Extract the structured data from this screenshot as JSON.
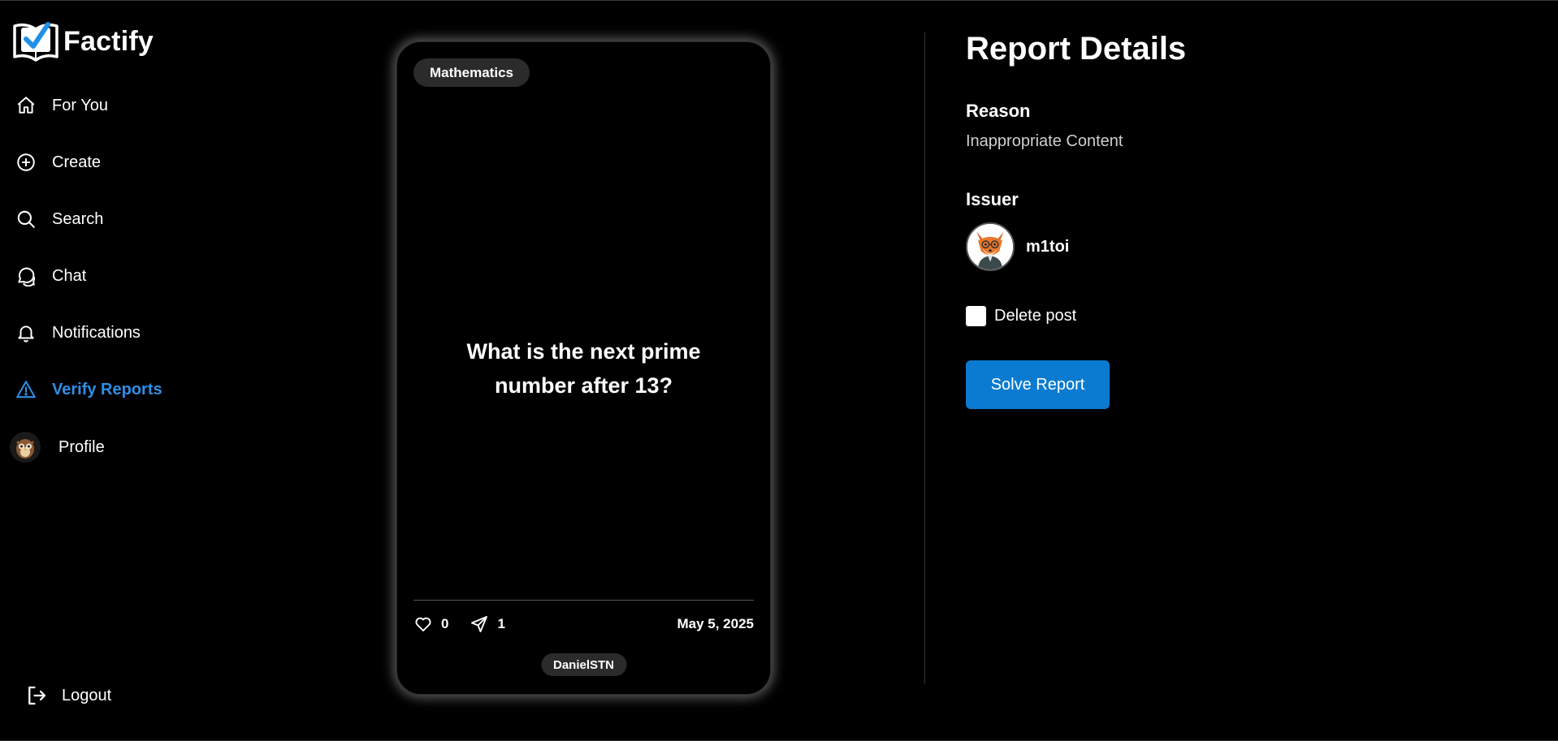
{
  "app": {
    "name": "Factify"
  },
  "sidebar": {
    "items": [
      {
        "label": "For You",
        "icon": "home-icon"
      },
      {
        "label": "Create",
        "icon": "plus-circle-icon"
      },
      {
        "label": "Search",
        "icon": "search-icon"
      },
      {
        "label": "Chat",
        "icon": "chat-icon"
      },
      {
        "label": "Notifications",
        "icon": "bell-icon"
      },
      {
        "label": "Verify Reports",
        "icon": "warning-icon",
        "active": true
      }
    ],
    "profile_label": "Profile",
    "logout_label": "Logout"
  },
  "post": {
    "category": "Mathematics",
    "question": "What is the next prime number after 13?",
    "likes": "0",
    "shares": "1",
    "date": "May 5, 2025",
    "author": "DanielSTN"
  },
  "report": {
    "title": "Report Details",
    "reason_heading": "Reason",
    "reason_value": "Inappropriate Content",
    "issuer_heading": "Issuer",
    "issuer_name": "m1toi",
    "delete_label": "Delete post",
    "delete_checked": false,
    "solve_button": "Solve Report"
  },
  "colors": {
    "background": "#000000",
    "accent": "#2f8fe6",
    "button": "#0a7bd1",
    "pill": "#2b2b2b"
  }
}
